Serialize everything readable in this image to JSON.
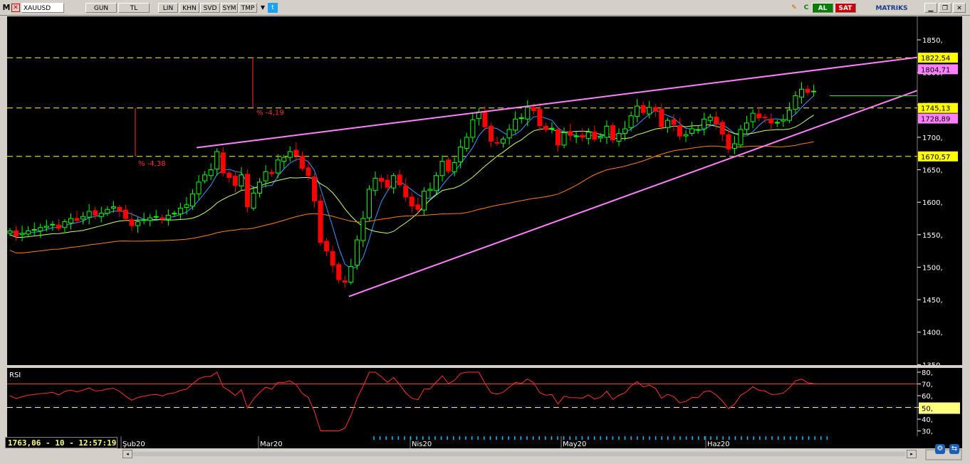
{
  "toolbar": {
    "app_icon": "M",
    "symbol": "XAUUSD",
    "buttons": [
      "GUN",
      "TL",
      "LIN",
      "KHN",
      "SVD",
      "SYM",
      "TMP"
    ],
    "buy_label": "AL",
    "sell_label": "SAT",
    "brand": "MATRIKS",
    "icons": [
      "pencil-icon",
      "refresh-icon",
      "twitter-icon",
      "minimize-icon",
      "restore-icon",
      "close-icon"
    ]
  },
  "price_axis": {
    "ticks": [
      "1850,",
      "1800,",
      "1750,",
      "1700,",
      "1650,",
      "1600,",
      "1550,",
      "1500,",
      "1450,",
      "1400,",
      "1350,"
    ]
  },
  "price_levels": [
    {
      "label": "1822,54",
      "value": 1822.54,
      "color": "#ffff00"
    },
    {
      "label": "1804,71",
      "value": 1804.71,
      "color": "#ff80ff"
    },
    {
      "label": "1745,13",
      "value": 1745.13,
      "color": "#ffff00"
    },
    {
      "label": "1728,89",
      "value": 1728.89,
      "color": "#ff80ff"
    },
    {
      "label": "1670,57",
      "value": 1670.57,
      "color": "#ffff00"
    }
  ],
  "annotations": [
    {
      "text": "% -4,19"
    },
    {
      "text": "% -4,38"
    }
  ],
  "rsi_panel": {
    "title": "RSI",
    "ticks": [
      "80,",
      "70,",
      "60,",
      "50,",
      "40,",
      "30,"
    ],
    "current_label": "50,",
    "upper_level": 70,
    "lower_level": 50
  },
  "time_axis": [
    "Şub20",
    "Mar20",
    "Nis20",
    "May20",
    "Haz20"
  ],
  "status": "1763,06 - 10 - 12:57:19",
  "colors": {
    "up": "#00ff00",
    "down": "#ff0000",
    "ma_fast": "#3399ff",
    "ma_mid": "#ccff66",
    "ma_slow": "#ff8000",
    "trend": "#ff80ff",
    "level": "#ffff00",
    "background": "#000000"
  },
  "chart_data": {
    "type": "candlestick",
    "y_range": [
      1350,
      1870
    ],
    "closes": [
      1556,
      1548,
      1552,
      1556,
      1558,
      1561,
      1563,
      1566,
      1560,
      1570,
      1575,
      1572,
      1578,
      1586,
      1580,
      1583,
      1589,
      1593,
      1587,
      1575,
      1564,
      1570,
      1573,
      1576,
      1578,
      1574,
      1580,
      1583,
      1591,
      1596,
      1613,
      1631,
      1642,
      1650,
      1678,
      1645,
      1638,
      1626,
      1642,
      1593,
      1614,
      1631,
      1647,
      1644,
      1665,
      1669,
      1678,
      1672,
      1652,
      1641,
      1602,
      1538,
      1525,
      1503,
      1481,
      1477,
      1501,
      1542,
      1575,
      1620,
      1637,
      1632,
      1623,
      1641,
      1627,
      1608,
      1594,
      1589,
      1617,
      1620,
      1641,
      1663,
      1648,
      1661,
      1685,
      1700,
      1727,
      1739,
      1716,
      1694,
      1691,
      1697,
      1712,
      1728,
      1730,
      1746,
      1741,
      1718,
      1712,
      1714,
      1688,
      1707,
      1703,
      1702,
      1700,
      1708,
      1697,
      1701,
      1717,
      1696,
      1706,
      1713,
      1733,
      1748,
      1738,
      1746,
      1741,
      1716,
      1726,
      1720,
      1702,
      1704,
      1713,
      1712,
      1728,
      1731,
      1721,
      1705,
      1682,
      1690,
      1712,
      1722,
      1737,
      1730,
      1730,
      1722,
      1723,
      1727,
      1742,
      1764,
      1774,
      1769,
      1771
    ]
  }
}
